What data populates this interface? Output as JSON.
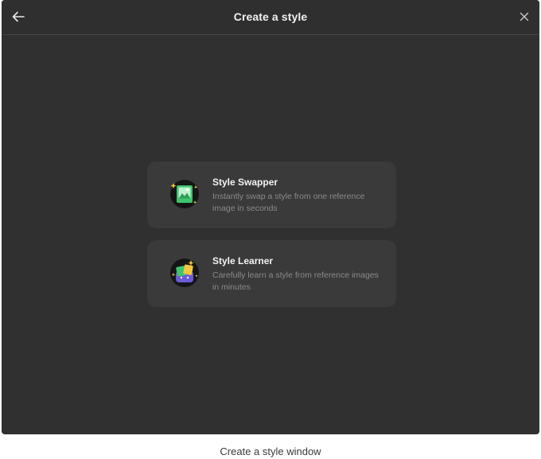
{
  "window": {
    "title": "Create a style",
    "back_icon": "arrow-left-icon",
    "close_icon": "close-icon"
  },
  "options": [
    {
      "title": "Style Swapper",
      "description": "Instantly swap a style from one reference image in seconds",
      "icon": "style-swapper-icon"
    },
    {
      "title": "Style Learner",
      "description": "Carefully learn a style from reference images in minutes",
      "icon": "style-learner-icon"
    }
  ],
  "caption": "Create a style window",
  "colors": {
    "window_bg": "#303030",
    "card_bg": "#3a3a3a",
    "accent_green": "#3ec46d",
    "accent_yellow": "#f5c542",
    "accent_purple": "#6b5bd6"
  }
}
